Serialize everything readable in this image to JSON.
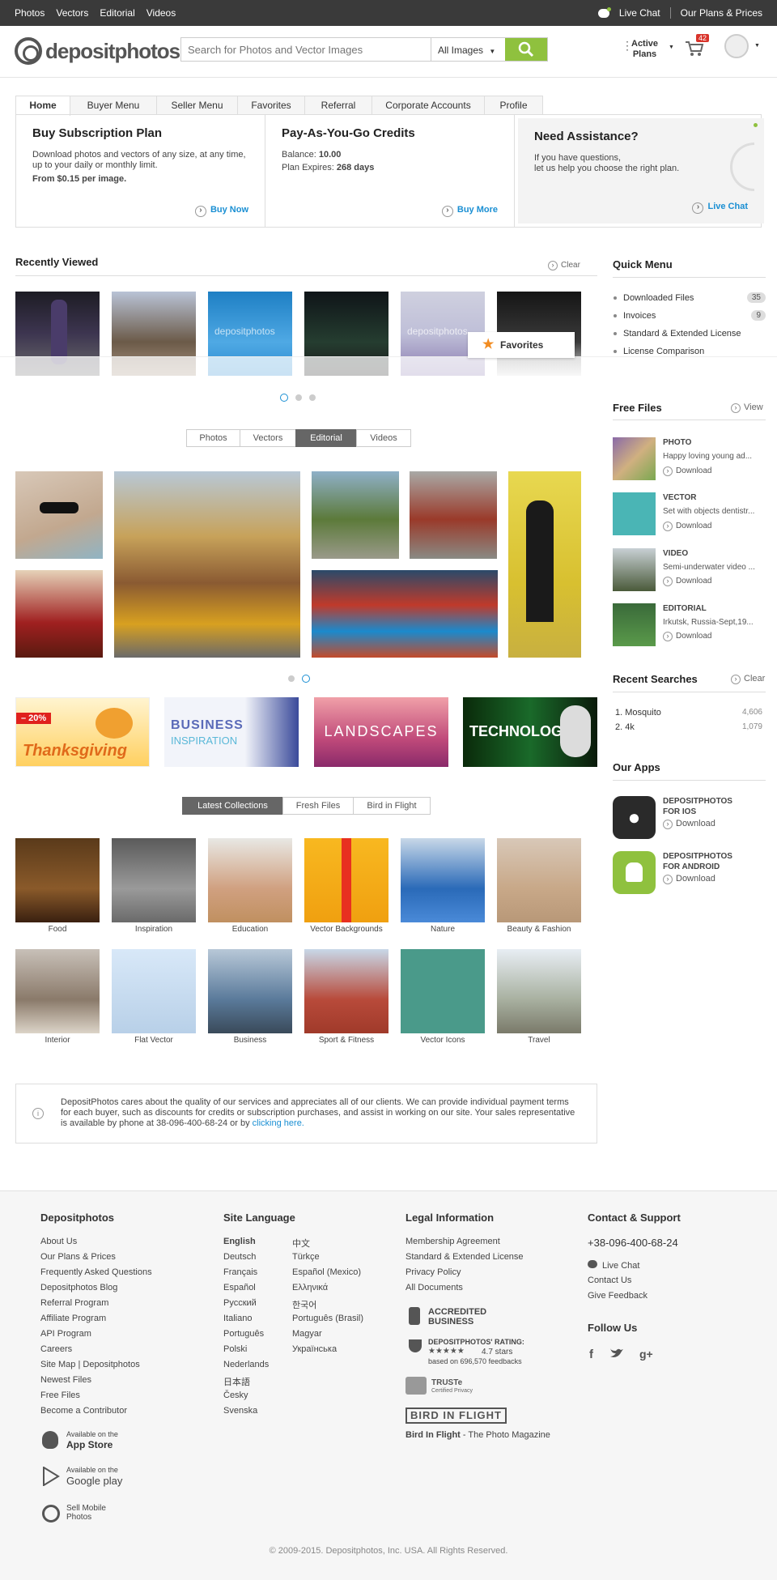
{
  "topbar": {
    "nav": [
      "Photos",
      "Vectors",
      "Editorial",
      "Videos"
    ],
    "live_chat": "Live Chat",
    "plans": "Our Plans & Prices"
  },
  "header": {
    "logo": "depositphotos",
    "search_placeholder": "Search for Photos and Vector Images",
    "search_filter": "All Images",
    "active": "Active",
    "plans": "Plans",
    "cart_count": "42"
  },
  "tabs": [
    "Home",
    "Buyer Menu",
    "Seller Menu",
    "Favorites",
    "Referral",
    "Corporate Accounts",
    "Profile"
  ],
  "panel": {
    "sub": {
      "title": "Buy Subscription Plan",
      "text": "Download photos and vectors of any size, at any time, up to your daily or monthly limit.",
      "price": "From $0.15 per image.",
      "link": "Buy Now"
    },
    "payg": {
      "title": "Pay-As-You-Go Credits",
      "balance_label": "Balance:",
      "balance": "10.00",
      "exp_label": "Plan Expires:",
      "exp": "268 days",
      "link": "Buy More"
    },
    "help": {
      "title": "Need Assistance?",
      "line1": "If you have questions,",
      "line2": "let us help you choose the right plan.",
      "link": "Live Chat"
    }
  },
  "recent": {
    "title": "Recently Viewed",
    "clear": "Clear",
    "watermark": "depositphotos",
    "favorites": "Favorites"
  },
  "quick": {
    "title": "Quick Menu",
    "items": [
      {
        "label": "Downloaded Files",
        "count": "35"
      },
      {
        "label": "Invoices",
        "count": "9"
      },
      {
        "label": "Standard & Extended License",
        "count": ""
      },
      {
        "label": "License Comparison",
        "count": ""
      }
    ]
  },
  "gallery_tabs": [
    "Photos",
    "Vectors",
    "Editorial",
    "Videos"
  ],
  "free": {
    "title": "Free Files",
    "view": "View",
    "download": "Download",
    "items": [
      {
        "type": "PHOTO",
        "desc": "Happy loving young ad..."
      },
      {
        "type": "VECTOR",
        "desc": "Set with objects dentistr..."
      },
      {
        "type": "VIDEO",
        "desc": "Semi-underwater video ..."
      },
      {
        "type": "EDITORIAL",
        "desc": "Irkutsk, Russia-Sept,19..."
      }
    ]
  },
  "banners": {
    "discount": "– 20%",
    "b1": "Thanksgiving",
    "b2a": "BUSINESS",
    "b2b": "INSPIRATION",
    "b3": "LANDSCAPES",
    "b4": "TECHNOLOGY"
  },
  "searches": {
    "title": "Recent Searches",
    "clear": "Clear",
    "items": [
      {
        "n": "1.",
        "term": "Mosquito",
        "count": "4,606"
      },
      {
        "n": "2.",
        "term": "4k",
        "count": "1,079"
      }
    ]
  },
  "apps": {
    "title": "Our Apps",
    "ios1": "DEPOSITPHOTOS",
    "ios2": "FOR IOS",
    "and1": "DEPOSITPHOTOS",
    "and2": "FOR ANDROID",
    "download": "Download"
  },
  "collection_tabs": [
    "Latest Collections",
    "Fresh Files",
    "Bird in Flight"
  ],
  "collections": [
    "Food",
    "Inspiration",
    "Education",
    "Vector Backgrounds",
    "Nature",
    "Beauty & Fashion",
    "Interior",
    "Flat Vector",
    "Business",
    "Sport & Fitness",
    "Vector Icons",
    "Travel"
  ],
  "notice": {
    "text": "DepositPhotos cares about the quality of our services and appreciates all of our clients. We can provide individual payment terms for each buyer, such as discounts for credits or subscription purchases, and assist in working on our site. Your sales representative is available by phone at 38-096-400-68-24 or by",
    "link": "clicking here."
  },
  "footer": {
    "c1_title": "Depositphotos",
    "c1": [
      "About Us",
      "Our Plans & Prices",
      "Frequently Asked Questions",
      "Depositphotos Blog",
      "Referral Program",
      "Affiliate Program",
      "API Program",
      "Careers",
      "Site Map | Depositphotos",
      "Newest Files",
      "Free Files",
      "Become a Contributor"
    ],
    "c2_title": "Site Language",
    "langs_a": [
      "English",
      "Deutsch",
      "Français",
      "Español",
      "Русский",
      "Italiano",
      "Português",
      "Polski",
      "Nederlands",
      "日本語",
      "Česky",
      "Svenska"
    ],
    "langs_b": [
      "中文",
      "Türkçe",
      "Español (Mexico)",
      "Ελληνικά",
      "한국어",
      "Português (Brasil)",
      "Magyar",
      "Українська"
    ],
    "c3_title": "Legal Information",
    "c3": [
      "Membership Agreement",
      "Standard & Extended License",
      "Privacy Policy",
      "All Documents"
    ],
    "bbb1": "ACCREDITED",
    "bbb2": "BUSINESS",
    "rating_label": "DEPOSITPHOTOS' RATING:",
    "rating_stars": "4.7 stars",
    "rating_based": "based on 696,570 feedbacks",
    "truste": "TRUSTe",
    "truste_sub": "Certified Privacy",
    "bif": "BIRD IN FLIGHT",
    "bif_name": "Bird In Flight",
    "bif_sub": " - The Photo Magazine",
    "c4_title": "Contact & Support",
    "phone": "+38-096-400-68-24",
    "c4": [
      "Live Chat",
      "Contact Us",
      "Give Feedback"
    ],
    "follow": "Follow Us",
    "app1a": "Available on the",
    "app1b": "App Store",
    "app2a": "Available on the",
    "app2b": "Google play",
    "app3a": "Sell Mobile",
    "app3b": "Photos",
    "copyright": "© 2009-2015. Depositphotos, Inc. USA. All Rights Reserved."
  },
  "colors": {
    "accent": "#8fc13e",
    "link": "#1a8fd3",
    "topbar": "#3a3a3a"
  }
}
